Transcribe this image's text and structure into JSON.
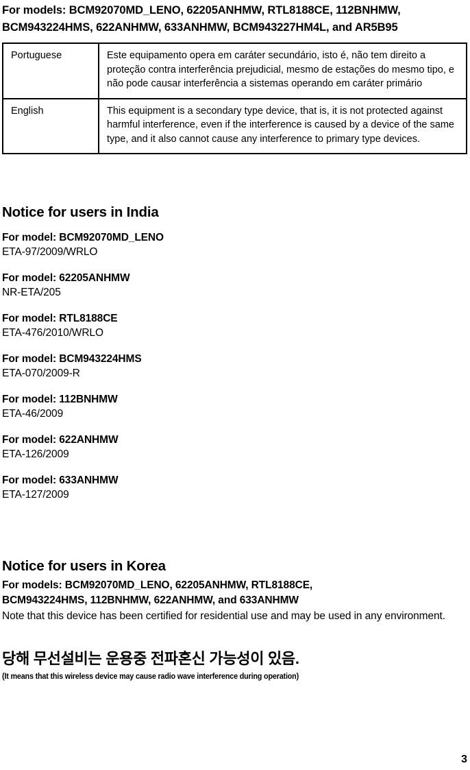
{
  "top_heading": {
    "line1": "For models: BCM92070MD_LENO, 62205ANHMW, RTL8188CE, 112BNHMW,",
    "line2": "BCM943224HMS, 622ANHMW, 633ANHMW, BCM943227HM4L, and AR5B95"
  },
  "language_table": {
    "rows": [
      {
        "language": "Portuguese",
        "text": "Este equipamento opera em caráter secundário, isto é, não tem direito a proteção contra interferência prejudicial, mesmo de estações do mesmo tipo, e não pode causar interferência a sistemas operando em caráter primário"
      },
      {
        "language": "English",
        "text": "This equipment is a secondary type device, that is, it is not protected against harmful interference, even if the interference is caused by a device of the same type, and it also cannot cause any interference to primary type devices."
      }
    ]
  },
  "india": {
    "heading": "Notice for users in India",
    "models": [
      {
        "title": "For model: BCM92070MD_LENO",
        "code": "ETA-97/2009/WRLO"
      },
      {
        "title": "For model: 62205ANHMW",
        "code": "NR-ETA/205"
      },
      {
        "title": "For model: RTL8188CE",
        "code": "ETA-476/2010/WRLO"
      },
      {
        "title": "For model: BCM943224HMS",
        "code": "ETA-070/2009-R"
      },
      {
        "title": "For model: 112BNHMW",
        "code": "ETA-46/2009"
      },
      {
        "title": "For model: 622ANHMW",
        "code": "ETA-126/2009"
      },
      {
        "title": "For model: 633ANHMW",
        "code": "ETA-127/2009"
      }
    ]
  },
  "korea": {
    "heading": "Notice for users in Korea",
    "models_line1": "For models:  BCM92070MD_LENO, 62205ANHMW, RTL8188CE,",
    "models_line2": "BCM943224HMS, 112BNHMW, 622ANHMW, and 633ANHMW",
    "note": "Note that this device has been certified for residential use and may be used in any environment.",
    "korean_text": "당해  무선설비는 운용중 전파혼신 가능성이 있음.",
    "korean_gloss": "(It means that this wireless device may cause radio wave interference during operation)"
  },
  "footer": {
    "page_number": "3"
  }
}
